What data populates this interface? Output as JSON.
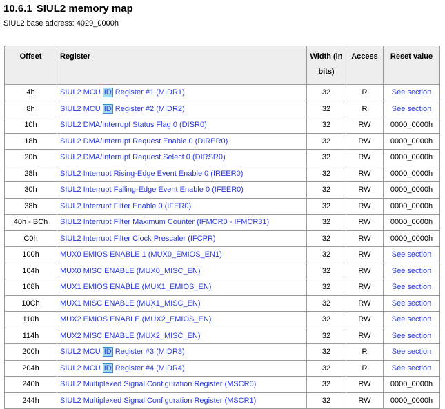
{
  "section": {
    "number": "10.6.1",
    "title": "SIUL2 memory map"
  },
  "base_address": "SIUL2 base address: 4029_0000h",
  "table": {
    "headers": {
      "offset": "Offset",
      "register": "Register",
      "width": "Width (in bits)",
      "access": "Access",
      "reset": "Reset value"
    },
    "rows": [
      {
        "offset": "4h",
        "register": [
          "SIUL2 MCU ",
          "ID",
          " Register #1 (MIDR1)"
        ],
        "width": "32",
        "access": "R",
        "reset": "See section",
        "link": true
      },
      {
        "offset": "8h",
        "register": [
          "SIUL2 MCU ",
          "ID",
          " Register #2 (MIDR2)"
        ],
        "width": "32",
        "access": "R",
        "reset": "See section",
        "link": true
      },
      {
        "offset": "10h",
        "register": [
          "SIUL2 DMA/Interrupt Status Flag 0 (DISR0)"
        ],
        "width": "32",
        "access": "RW",
        "reset": "0000_0000h",
        "link": false
      },
      {
        "offset": "18h",
        "register": [
          "SIUL2 DMA/Interrupt Request Enable 0 (DIRER0)"
        ],
        "width": "32",
        "access": "RW",
        "reset": "0000_0000h",
        "link": false
      },
      {
        "offset": "20h",
        "register": [
          "SIUL2 DMA/Interrupt Request Select 0 (DIRSR0)"
        ],
        "width": "32",
        "access": "RW",
        "reset": "0000_0000h",
        "link": false
      },
      {
        "offset": "28h",
        "register": [
          "SIUL2 Interrupt Rising-Edge Event Enable 0 (IREER0)"
        ],
        "width": "32",
        "access": "RW",
        "reset": "0000_0000h",
        "link": false
      },
      {
        "offset": "30h",
        "register": [
          "SIUL2 Interrupt Falling-Edge Event Enable 0 (IFEER0)"
        ],
        "width": "32",
        "access": "RW",
        "reset": "0000_0000h",
        "link": false
      },
      {
        "offset": "38h",
        "register": [
          "SIUL2 Interrupt Filter Enable 0 (IFER0)"
        ],
        "width": "32",
        "access": "RW",
        "reset": "0000_0000h",
        "link": false
      },
      {
        "offset": "40h - BCh",
        "register": [
          "SIUL2 Interrupt Filter Maximum Counter (IFMCR0 - IFMCR31)"
        ],
        "width": "32",
        "access": "RW",
        "reset": "0000_0000h",
        "link": false
      },
      {
        "offset": "C0h",
        "register": [
          "SIUL2 Interrupt Filter Clock Prescaler (IFCPR)"
        ],
        "width": "32",
        "access": "RW",
        "reset": "0000_0000h",
        "link": false
      },
      {
        "offset": "100h",
        "register": [
          "MUX0 EMIOS ENABLE 1 (MUX0_EMIOS_EN1)"
        ],
        "width": "32",
        "access": "RW",
        "reset": "See section",
        "link": true
      },
      {
        "offset": "104h",
        "register": [
          "MUX0 MISC ENABLE (MUX0_MISC_EN)"
        ],
        "width": "32",
        "access": "RW",
        "reset": "See section",
        "link": true
      },
      {
        "offset": "108h",
        "register": [
          "MUX1 EMIOS ENABLE (MUX1_EMIOS_EN)"
        ],
        "width": "32",
        "access": "RW",
        "reset": "See section",
        "link": true
      },
      {
        "offset": "10Ch",
        "register": [
          "MUX1 MISC ENABLE (MUX1_MISC_EN)"
        ],
        "width": "32",
        "access": "RW",
        "reset": "See section",
        "link": true
      },
      {
        "offset": "110h",
        "register": [
          "MUX2 EMIOS ENABLE (MUX2_EMIOS_EN)"
        ],
        "width": "32",
        "access": "RW",
        "reset": "See section",
        "link": true
      },
      {
        "offset": "114h",
        "register": [
          "MUX2 MISC ENABLE (MUX2_MISC_EN)"
        ],
        "width": "32",
        "access": "RW",
        "reset": "See section",
        "link": true
      },
      {
        "offset": "200h",
        "register": [
          "SIUL2 MCU ",
          "ID",
          " Register #3 (MIDR3)"
        ],
        "width": "32",
        "access": "R",
        "reset": "See section",
        "link": true
      },
      {
        "offset": "204h",
        "register": [
          "SIUL2 MCU ",
          "ID",
          " Register #4 (MIDR4)"
        ],
        "width": "32",
        "access": "R",
        "reset": "See section",
        "link": true
      },
      {
        "offset": "240h",
        "register": [
          "SIUL2 Multiplexed Signal Configuration Register (MSCR0)"
        ],
        "width": "32",
        "access": "RW",
        "reset": "0000_0000h",
        "link": false
      },
      {
        "offset": "244h",
        "register": [
          "SIUL2 Multiplexed Signal Configuration Register (MSCR1)"
        ],
        "width": "32",
        "access": "RW",
        "reset": "0000_0000h",
        "link": false
      }
    ]
  }
}
